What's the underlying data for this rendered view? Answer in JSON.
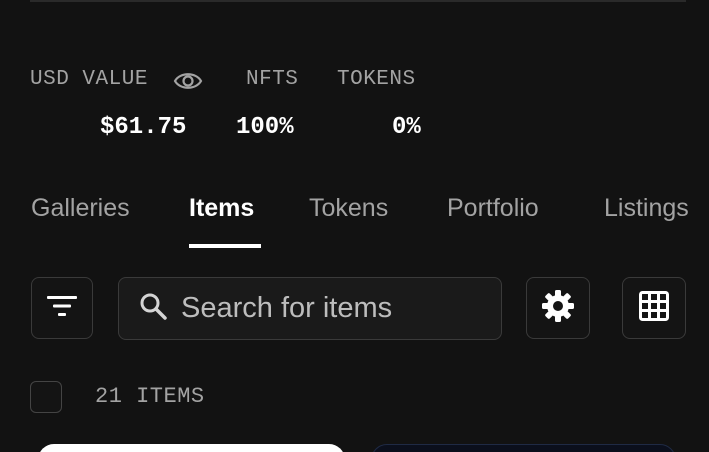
{
  "stats": {
    "usd_value_label": "USD VALUE",
    "usd_value": "$61.75",
    "nfts_label": "NFTS",
    "nfts_value": "100%",
    "tokens_label": "TOKENS",
    "tokens_value": "0%",
    "visibility_icon": "eye-icon"
  },
  "tabs": [
    {
      "label": "Galleries",
      "active": false
    },
    {
      "label": "Items",
      "active": true
    },
    {
      "label": "Tokens",
      "active": false
    },
    {
      "label": "Portfolio",
      "active": false
    },
    {
      "label": "Listings",
      "active": false
    }
  ],
  "toolbar": {
    "filter_icon": "filter-icon",
    "search_icon": "search-icon",
    "search_placeholder": "Search for items",
    "settings_icon": "gear-icon",
    "view_icon": "grid-icon"
  },
  "items": {
    "count_label": "21 ITEMS"
  },
  "colors": {
    "background": "#121212",
    "text_primary": "#ffffff",
    "text_secondary": "#a3a3a3",
    "border": "#3a3a3a"
  }
}
